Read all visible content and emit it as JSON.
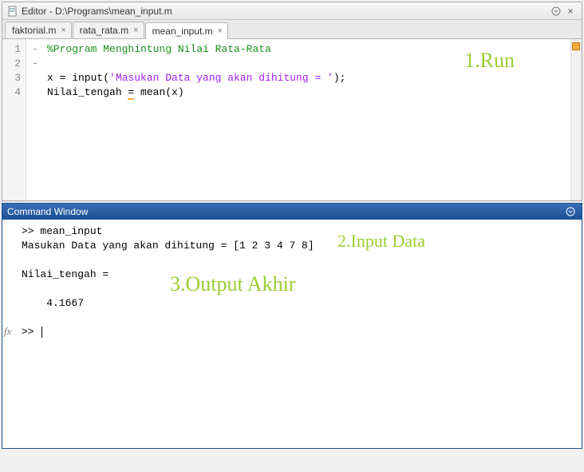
{
  "editor": {
    "title": "Editor - D:\\Programs\\mean_input.m",
    "tabs": [
      {
        "label": "faktorial.m"
      },
      {
        "label": "rata_rata.m"
      },
      {
        "label": "mean_input.m"
      }
    ],
    "active_tab": 2,
    "line_numbers": [
      "1",
      "2",
      "3",
      "4"
    ],
    "break_markers": [
      "",
      "",
      "-",
      "-"
    ],
    "code_lines": {
      "l1_comment": "%Program Menghintung Nilai Rata-Rata",
      "l3_pre": "x = input(",
      "l3_str": "'Masukan Data yang akan dihitung = '",
      "l3_post": ");",
      "l4_pre": "Nilai_tengah ",
      "l4_eq": "=",
      "l4_post": " mean(x)"
    },
    "annotations": {
      "run": "1.Run"
    }
  },
  "command": {
    "title": "Command Window",
    "body": ">> mean_input\nMasukan Data yang akan dihitung = [1 2 3 4 7 8]\n\nNilai_tengah =\n\n    4.1667\n\n>> ",
    "fx": "fx",
    "annotations": {
      "input": "2.Input Data",
      "output": "3.Output Akhir"
    }
  },
  "icons": {
    "close": "×",
    "dropdown": "⌄",
    "minimize_panel": "⊙"
  }
}
